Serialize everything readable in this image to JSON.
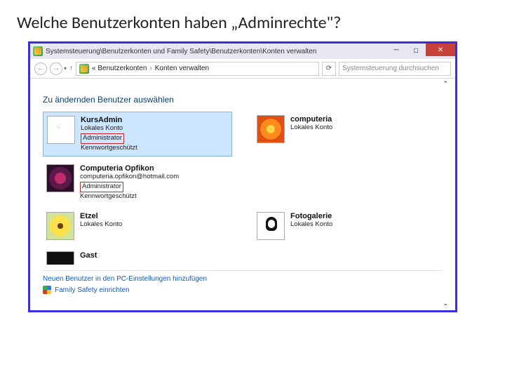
{
  "slide_title": "Welche Benutzerkonten haben „Adminrechte\"?",
  "window": {
    "title_path": "Systemsteuerung\\Benutzerkonten und Family Safety\\Benutzerkonten\\Konten verwalten",
    "breadcrumb_left": "« Benutzerkonten",
    "breadcrumb_right": "Konten verwalten",
    "search_placeholder": "Systemsteuerung durchsuchen",
    "subtitle": "Zu ändernden Benutzer auswählen",
    "accounts": [
      {
        "name": "KursAdmin",
        "lines": [
          "Lokales Konto",
          "Administrator",
          "Kennwortgeschützt"
        ],
        "highlight_idx": 1,
        "avatar": "av-ball",
        "selected": true
      },
      {
        "name": "computeria",
        "lines": [
          "Lokales Konto"
        ],
        "highlight_idx": -1,
        "avatar": "av-flower-o",
        "selected": false
      },
      {
        "name": "Computeria Opfikon",
        "lines": [
          "computeria.opfikon@hotmail.com",
          "Administrator",
          "Kennwortgeschützt"
        ],
        "highlight_idx": 1,
        "avatar": "av-spiral",
        "selected": false
      },
      {
        "name": "Etzel",
        "lines": [
          "Lokales Konto"
        ],
        "highlight_idx": -1,
        "avatar": "av-flower-y",
        "selected": false
      },
      {
        "name": "Fotogalerie",
        "lines": [
          "Lokales Konto"
        ],
        "highlight_idx": -1,
        "avatar": "av-dog",
        "selected": false
      },
      {
        "name": "Gast",
        "lines": [],
        "highlight_idx": -1,
        "avatar": "av-dark",
        "selected": false,
        "partial": true
      }
    ],
    "link_add_user": "Neuen Benutzer in den PC-Einstellungen hinzufügen",
    "link_family": "Family Safety einrichten"
  }
}
